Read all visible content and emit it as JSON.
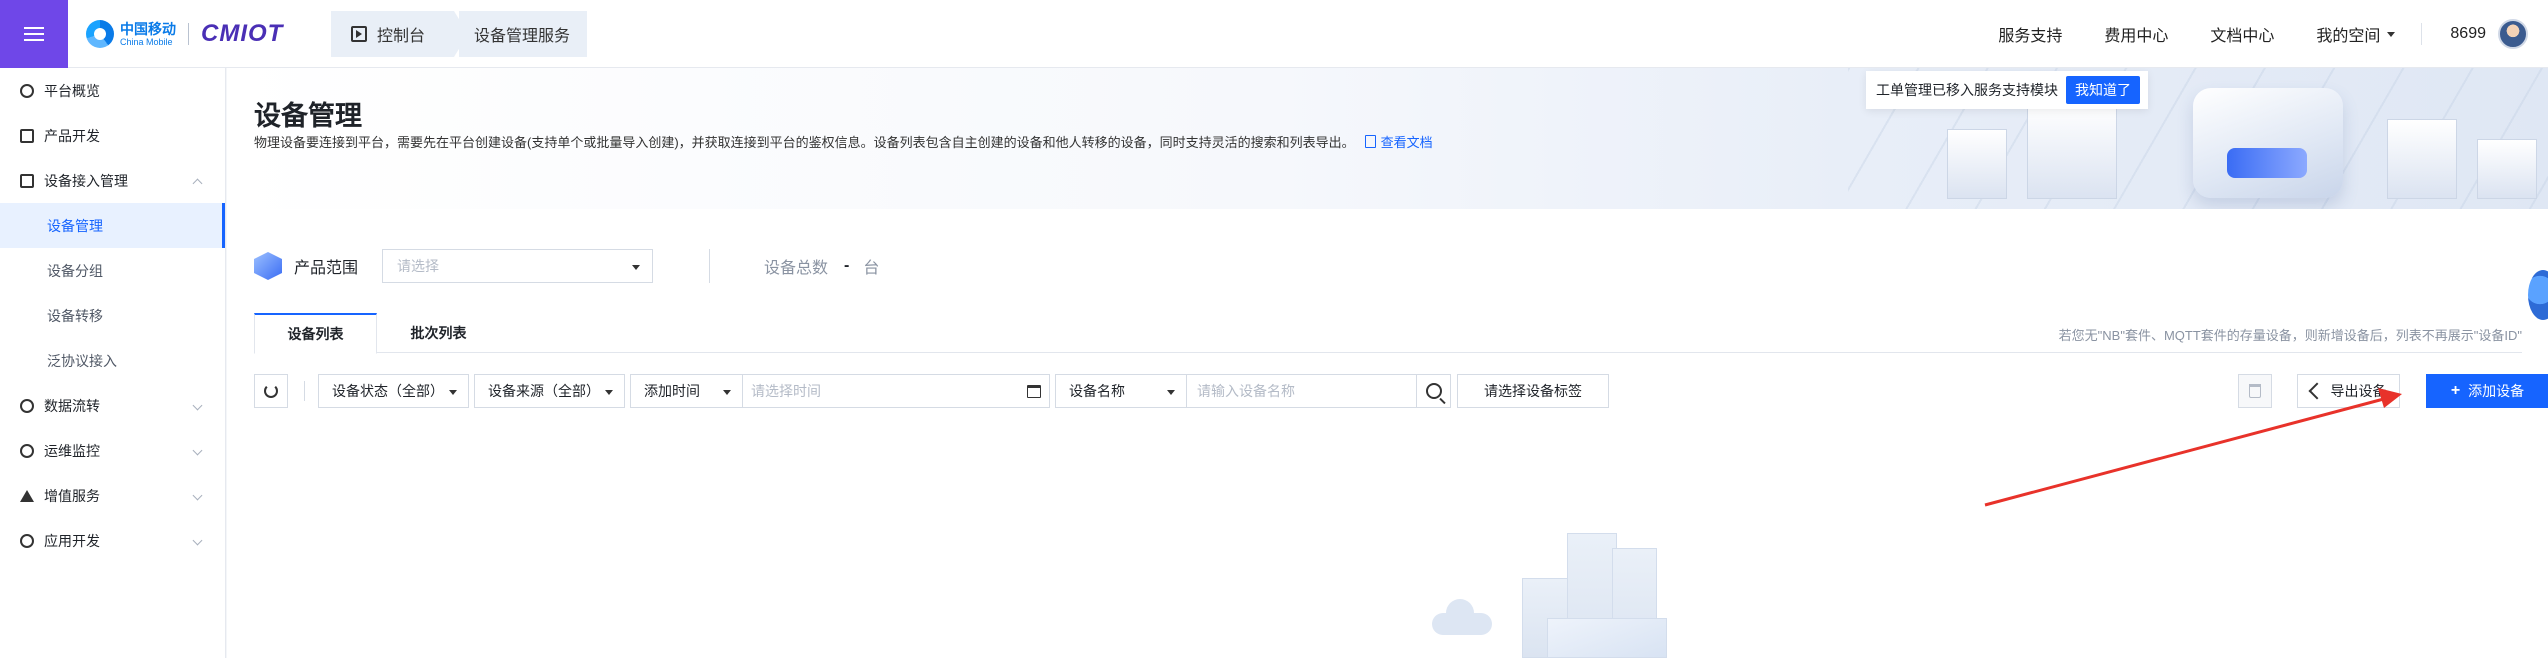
{
  "header": {
    "logo_cn": "中国移动",
    "logo_en": "China Mobile",
    "logo_brand": "CMIOT",
    "breadcrumb": [
      "控制台",
      "设备管理服务"
    ],
    "links": [
      "服务支持",
      "费用中心",
      "文档中心"
    ],
    "space_label": "我的空间",
    "user_id": "8699"
  },
  "sidebar": {
    "items": [
      {
        "label": "平台概览",
        "icon": "overview-icon"
      },
      {
        "label": "产品开发",
        "icon": "product-icon"
      },
      {
        "label": "设备接入管理",
        "icon": "device-access-icon",
        "expanded": true
      },
      {
        "label": "设备管理",
        "sub": true,
        "active": true
      },
      {
        "label": "设备分组",
        "sub": true
      },
      {
        "label": "设备转移",
        "sub": true
      },
      {
        "label": "泛协议接入",
        "sub": true
      },
      {
        "label": "数据流转",
        "icon": "data-flow-icon"
      },
      {
        "label": "运维监控",
        "icon": "monitor-icon"
      },
      {
        "label": "增值服务",
        "icon": "value-added-icon"
      },
      {
        "label": "应用开发",
        "icon": "app-dev-icon"
      }
    ]
  },
  "banner": {
    "notice_text": "工单管理已移入服务支持模块",
    "notice_button": "我知道了"
  },
  "page": {
    "title": "设备管理",
    "description": "物理设备要连接到平台，需要先在平台创建设备(支持单个或批量导入创建)，并获取连接到平台的鉴权信息。设备列表包含自主创建的设备和他人转移的设备，同时支持灵活的搜索和列表导出。",
    "doc_link": "查看文档"
  },
  "range": {
    "label": "产品范围",
    "placeholder": "请选择",
    "total_label": "设备总数",
    "total_value": "-",
    "total_unit": "台"
  },
  "tabs": {
    "items": [
      "设备列表",
      "批次列表"
    ],
    "active": 0,
    "hint": "若您无\"NB\"套件、MQTT套件的存量设备，则新增设备后，列表不再展示\"设备ID\""
  },
  "toolbar": {
    "status_filter": "设备状态（全部）",
    "source_filter": "设备来源（全部）",
    "time_filter": "添加时间",
    "time_placeholder": "请选择时间",
    "name_filter": "设备名称",
    "name_placeholder": "请输入设备名称",
    "tag_button": "请选择设备标签",
    "export_button": "导出设备",
    "add_button": "添加设备"
  },
  "colors": {
    "accent": "#1664ff",
    "menu_purple": "#6f47e8",
    "annotation_arrow": "#e8322a"
  }
}
